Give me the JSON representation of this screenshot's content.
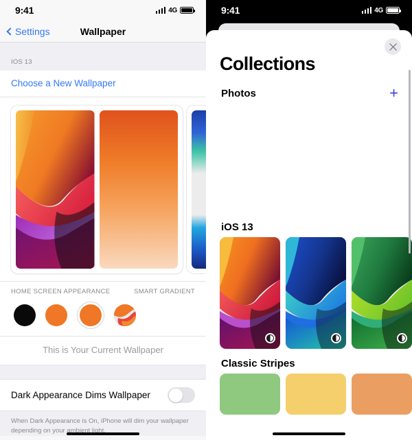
{
  "left": {
    "status": {
      "time": "9:41",
      "network": "4G",
      "signal_bars": 4
    },
    "nav": {
      "back_label": "Settings",
      "title": "Wallpaper"
    },
    "section_header": "IOS 13",
    "choose_link": "Choose a New Wallpaper",
    "appearance": {
      "left_label": "HOME SCREEN APPEARANCE",
      "right_label": "SMART GRADIENT",
      "swatches": [
        {
          "name": "black",
          "color": "#090909",
          "selected": false
        },
        {
          "name": "orange-solid",
          "color": "#ef7725",
          "selected": false
        },
        {
          "name": "orange-selected",
          "color": "#ef7725",
          "selected": true
        },
        {
          "name": "gradient-preview",
          "color": "#ef7725",
          "selected": false
        }
      ]
    },
    "current_wallpaper_text": "This is Your Current Wallpaper",
    "toggle": {
      "label": "Dark Appearance Dims Wallpaper",
      "on": false
    },
    "footnote": "When Dark Appearance is On, iPhone will dim your wallpaper depending on your ambient light."
  },
  "right": {
    "status": {
      "time": "9:41",
      "network": "4G",
      "signal_bars": 4
    },
    "close_label": "Close",
    "title": "Collections",
    "photos": {
      "label": "Photos",
      "add_label": "+"
    },
    "sections": [
      {
        "title": "iOS 13",
        "thumbs": [
          {
            "name": "ios13-orange-wallpaper",
            "has_dark_badge": true
          },
          {
            "name": "ios13-blue-wallpaper",
            "has_dark_badge": true
          },
          {
            "name": "ios13-green-wallpaper",
            "has_dark_badge": true
          },
          {
            "name": "ios13-gray-wallpaper",
            "has_dark_badge": false
          }
        ]
      },
      {
        "title": "Classic Stripes",
        "stripes": [
          {
            "name": "stripe-green",
            "color": "#8ec97f"
          },
          {
            "name": "stripe-yellow",
            "color": "#f5cf6b"
          },
          {
            "name": "stripe-orange",
            "color": "#eb9e62"
          },
          {
            "name": "stripe-pink",
            "color": "#e58a9a"
          }
        ]
      }
    ]
  },
  "colors": {
    "accent_blue": "#3478f6",
    "plus_purple": "#3d3de0",
    "group_bg": "#efeff4"
  }
}
